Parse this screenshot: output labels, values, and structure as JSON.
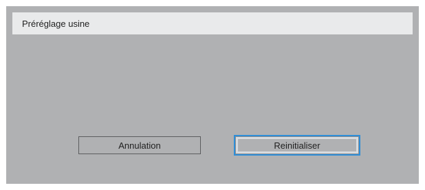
{
  "dialog": {
    "title": "Préréglage usine",
    "buttons": {
      "cancel_label": "Annulation",
      "reset_label": "Reinitialiser"
    },
    "focused_button": "reset"
  },
  "colors": {
    "panel_background": "#b0b1b3",
    "title_bar_background": "#e9eaeb",
    "focus_outline": "#2e8ed8"
  }
}
